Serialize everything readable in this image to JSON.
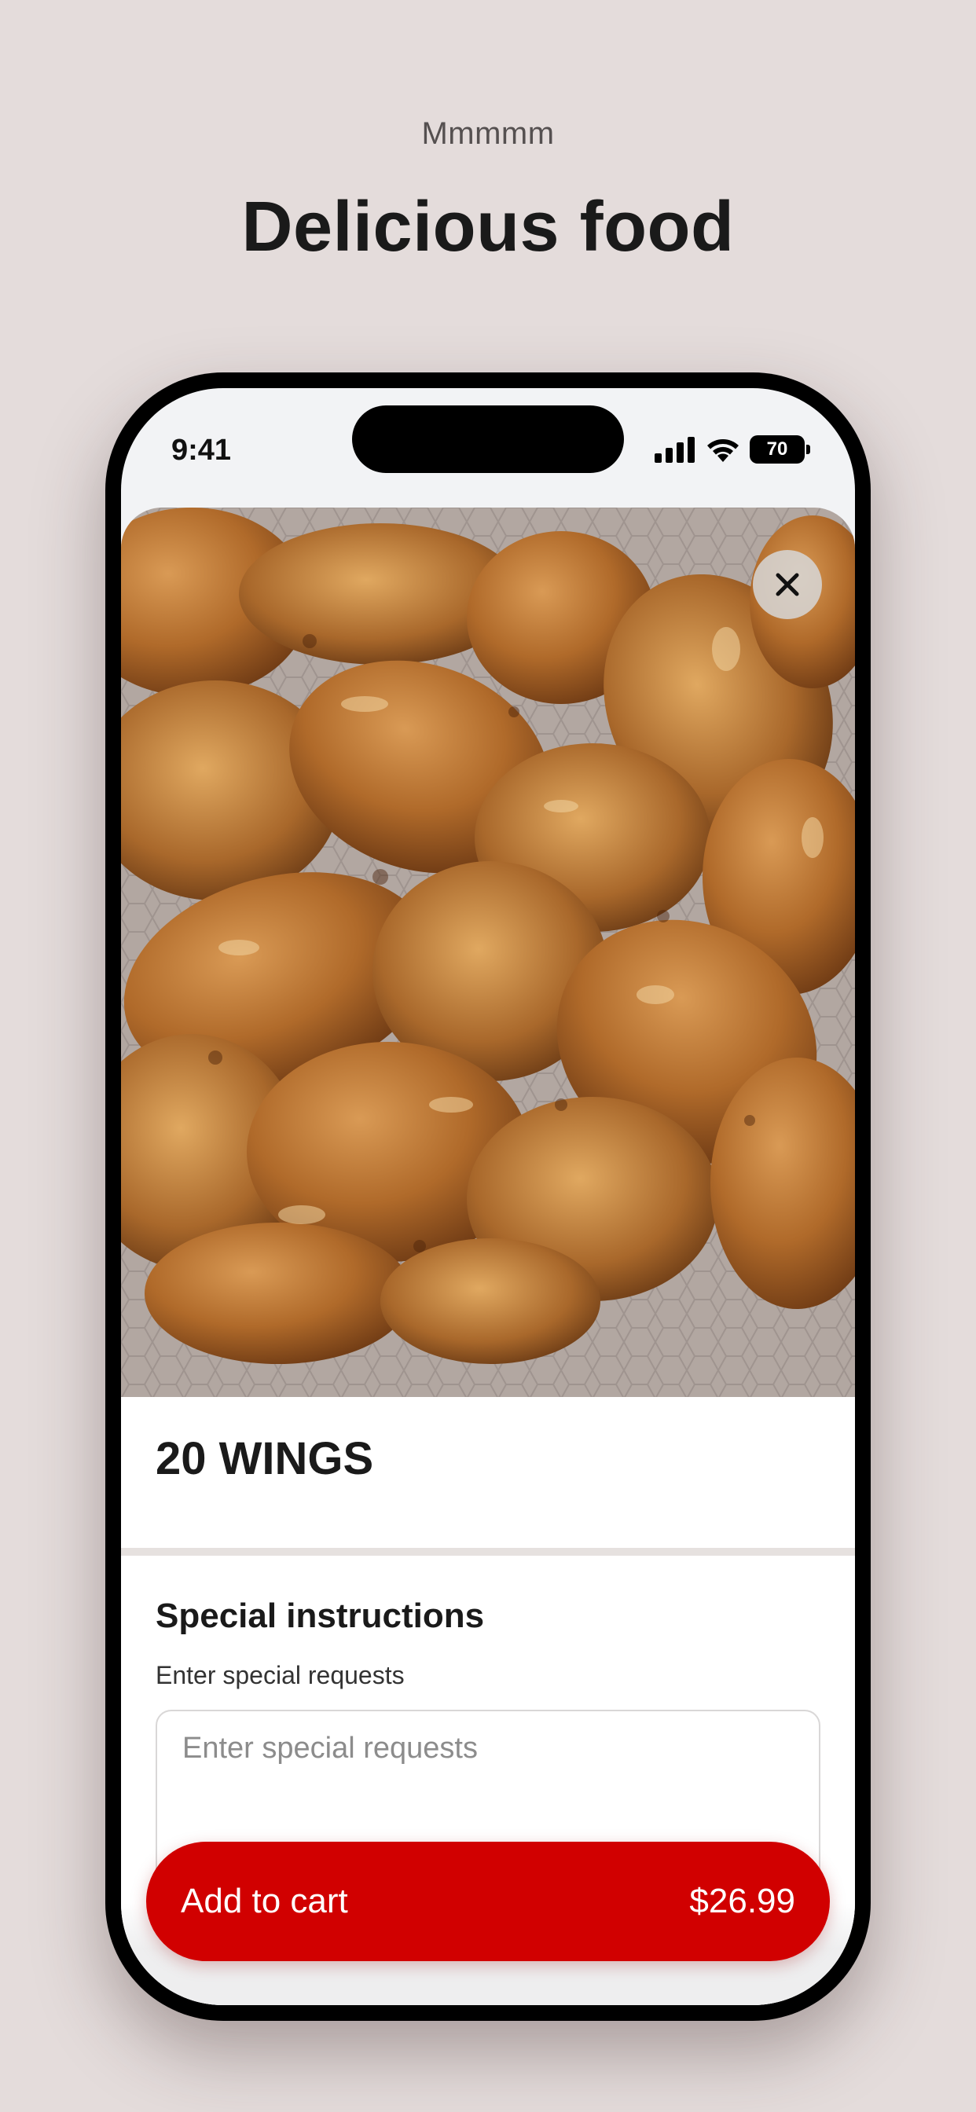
{
  "promo": {
    "subtitle": "Mmmmm",
    "title": "Delicious food"
  },
  "status_bar": {
    "time": "9:41",
    "battery": "70",
    "icons": [
      "cellular-signal-icon",
      "wifi-icon",
      "battery-icon"
    ]
  },
  "item": {
    "photo": "fried-chicken-wings-photo",
    "title": "20 WINGS"
  },
  "close": {
    "icon": "close-icon"
  },
  "instructions": {
    "heading": "Special instructions",
    "label": "Enter special requests",
    "placeholder": "Enter special requests",
    "value": ""
  },
  "cart_button": {
    "label": "Add to cart",
    "price": "$26.99"
  },
  "colors": {
    "background": "#e4dcdb",
    "accent": "#d10000",
    "text": "#1a1a1a"
  }
}
